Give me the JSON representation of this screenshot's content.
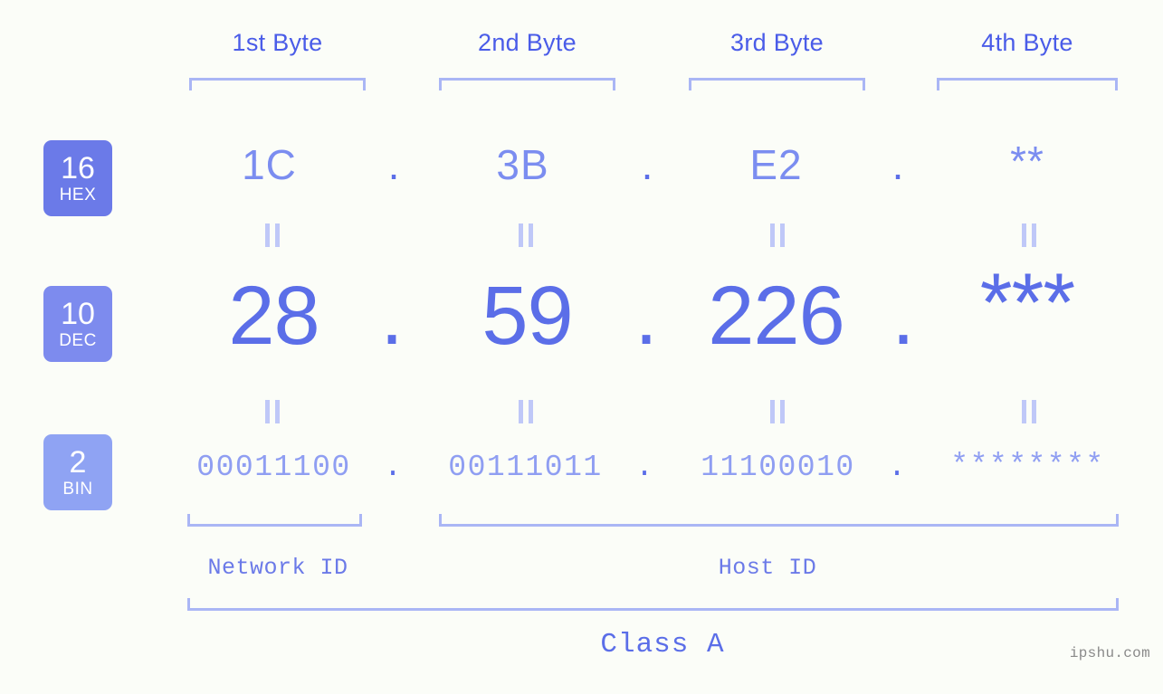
{
  "theme": {
    "background": "#fbfdf8",
    "accent_strong": "#5b6ee8",
    "accent_mid": "#7b8df0",
    "accent_light": "#aab6f5",
    "bracket": "#aab6f5",
    "badge_hex_bg": "#6b7ae8",
    "badge_dec_bg": "#7d8bee",
    "badge_bin_bg": "#8fa3f3",
    "watermark_color": "#8a8a8a"
  },
  "byte_headers": [
    {
      "label": "1st Byte"
    },
    {
      "label": "2nd Byte"
    },
    {
      "label": "3rd Byte"
    },
    {
      "label": "4th Byte"
    }
  ],
  "bases": [
    {
      "radix": "16",
      "name": "HEX"
    },
    {
      "radix": "10",
      "name": "DEC"
    },
    {
      "radix": "2",
      "name": "BIN"
    }
  ],
  "separator": ".",
  "rows": {
    "hex": {
      "base_label": "HEX",
      "radix": "16",
      "values": [
        "1C",
        "3B",
        "E2",
        "**"
      ]
    },
    "dec": {
      "base_label": "DEC",
      "radix": "10",
      "values": [
        "28",
        "59",
        "226",
        "***"
      ]
    },
    "bin": {
      "base_label": "BIN",
      "radix": "2",
      "values": [
        "00011100",
        "00111011",
        "11100010",
        "********"
      ]
    }
  },
  "equals_symbol": "=",
  "id_sections": [
    {
      "label": "Network ID"
    },
    {
      "label": "Host ID"
    }
  ],
  "class_label": "Class A",
  "watermark": "ipshu.com"
}
